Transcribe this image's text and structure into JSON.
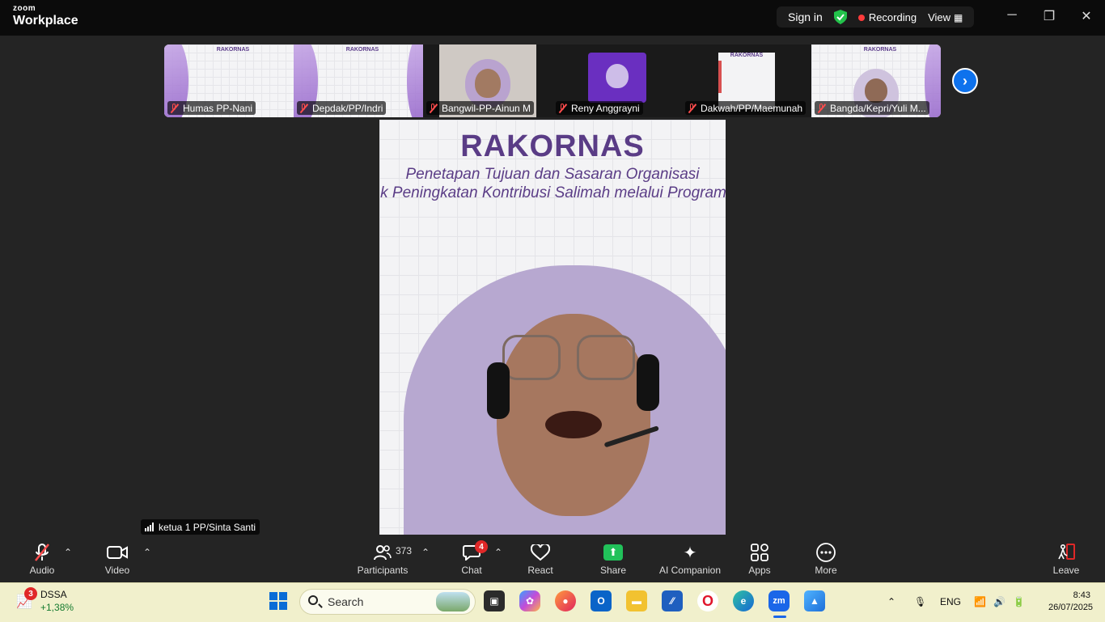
{
  "app": {
    "brand_top": "zoom",
    "brand_name": "Workplace"
  },
  "titlebar": {
    "signin": "Sign in",
    "recording": "Recording",
    "view": "View"
  },
  "thumbnails": [
    {
      "name": "Humas PP-Nani",
      "slide_title": "RAKORNAS"
    },
    {
      "name": "Depdak/PP/Indri",
      "slide_title": "RAKORNAS"
    },
    {
      "name": "Bangwil-PP-Ainun M"
    },
    {
      "name": "Reny Anggrayni"
    },
    {
      "name": "Dakwah/PP/Maemunah",
      "slide_title": "RAKORNAS"
    },
    {
      "name": "Bangda/Kepri/Yuli M...",
      "slide_title": "RAKORNAS"
    }
  ],
  "main_video": {
    "slide_title": "RAKORNAS",
    "slide_line1": "Penetapan Tujuan dan Sasaran Organisasi",
    "slide_line2": "k Peningkatan Kontribusi Salimah melalui Program",
    "speaker": "ketua 1 PP/Sinta Santi"
  },
  "toolbar": {
    "audio": "Audio",
    "video": "Video",
    "participants": "Participants",
    "participants_count": "373",
    "chat": "Chat",
    "chat_badge": "4",
    "react": "React",
    "share": "Share",
    "ai_companion": "AI Companion",
    "apps": "Apps",
    "more": "More",
    "leave": "Leave"
  },
  "taskbar": {
    "stock_name": "DSSA",
    "stock_change": "+1,38%",
    "stock_badge": "3",
    "search_placeholder": "Search",
    "lang": "ENG",
    "time": "8:43",
    "date": "26/07/2025"
  },
  "colors": {
    "accent": "#0e72ed",
    "recording": "#ff3b3b",
    "share": "#21c15a",
    "slide_text": "#5a3c86"
  }
}
